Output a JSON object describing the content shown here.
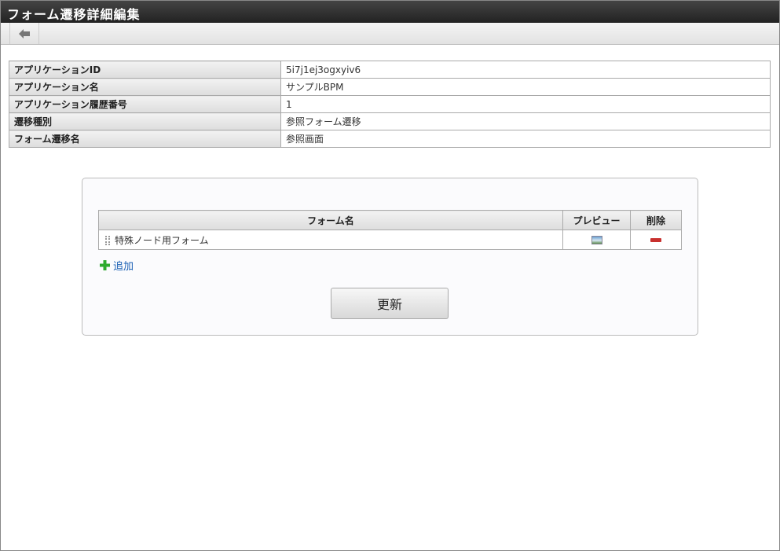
{
  "window": {
    "title": "フォーム遷移詳細編集"
  },
  "toolbar": {
    "back_icon": "arrow-left-icon"
  },
  "info": [
    {
      "label": "アプリケーションID",
      "value": "5i7j1ej3ogxyiv6"
    },
    {
      "label": "アプリケーション名",
      "value": "サンプルBPM"
    },
    {
      "label": "アプリケーション履歴番号",
      "value": "1"
    },
    {
      "label": "遷移種別",
      "value": "参照フォーム遷移"
    },
    {
      "label": "フォーム遷移名",
      "value": "参照画面"
    }
  ],
  "forms": {
    "headers": {
      "name": "フォーム名",
      "preview": "プレビュー",
      "delete": "削除"
    },
    "rows": [
      {
        "name": "特殊ノード用フォーム"
      }
    ],
    "add_label": "追加",
    "update_label": "更新"
  }
}
